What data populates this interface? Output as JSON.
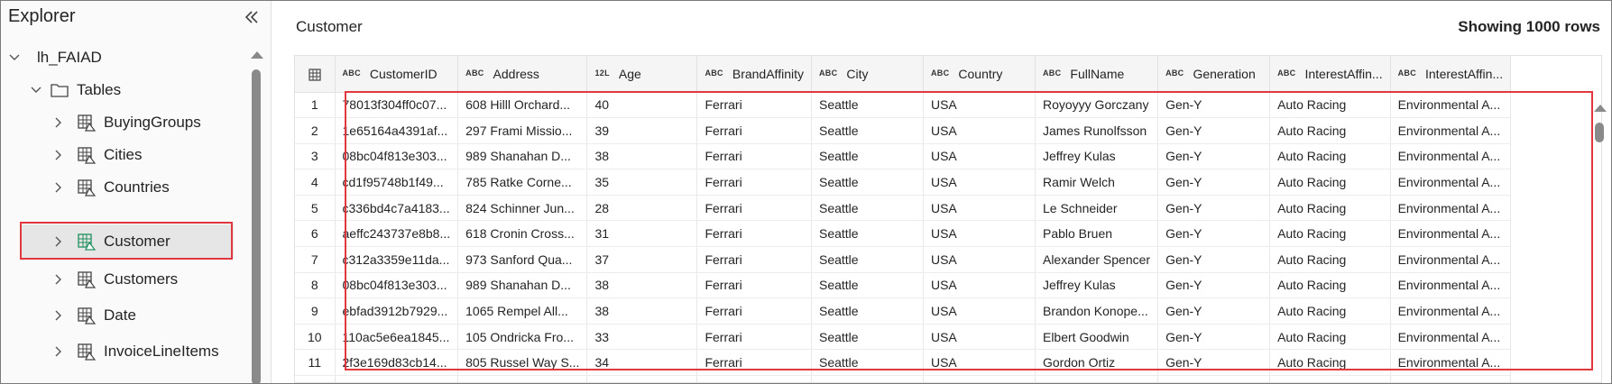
{
  "explorer": {
    "title": "Explorer",
    "lakehouse": "lh_FAIAD",
    "tables_label": "Tables",
    "items": [
      {
        "label": "BuyingGroups"
      },
      {
        "label": "Cities"
      },
      {
        "label": "Countries"
      },
      {
        "label": "Customer",
        "selected": true
      },
      {
        "label": "Customers"
      },
      {
        "label": "Date"
      },
      {
        "label": "InvoiceLineItems"
      }
    ]
  },
  "main": {
    "title": "Customer",
    "rows_count": "Showing 1000 rows"
  },
  "table": {
    "columns": [
      {
        "type": "ABC",
        "name": "CustomerID"
      },
      {
        "type": "ABC",
        "name": "Address"
      },
      {
        "type": "12L",
        "name": "Age"
      },
      {
        "type": "ABC",
        "name": "BrandAffinity"
      },
      {
        "type": "ABC",
        "name": "City"
      },
      {
        "type": "ABC",
        "name": "Country"
      },
      {
        "type": "ABC",
        "name": "FullName"
      },
      {
        "type": "ABC",
        "name": "Generation"
      },
      {
        "type": "ABC",
        "name": "InterestAffin..."
      },
      {
        "type": "ABC",
        "name": "InterestAffin..."
      }
    ],
    "rows": [
      [
        "1",
        "78013f304ff0c07...",
        "608 Hilll Orchard...",
        "40",
        "Ferrari",
        "Seattle",
        "USA",
        "Royoyyy Gorczany",
        "Gen-Y",
        "Auto Racing",
        "Environmental A..."
      ],
      [
        "2",
        "1e65164a4391af...",
        "297 Frami Missio...",
        "39",
        "Ferrari",
        "Seattle",
        "USA",
        "James Runolfsson",
        "Gen-Y",
        "Auto Racing",
        "Environmental A..."
      ],
      [
        "3",
        "08bc04f813e303...",
        "989 Shanahan D...",
        "38",
        "Ferrari",
        "Seattle",
        "USA",
        "Jeffrey Kulas",
        "Gen-Y",
        "Auto Racing",
        "Environmental A..."
      ],
      [
        "4",
        "cd1f95748b1f49...",
        "785 Ratke Corne...",
        "35",
        "Ferrari",
        "Seattle",
        "USA",
        "Ramir Welch",
        "Gen-Y",
        "Auto Racing",
        "Environmental A..."
      ],
      [
        "5",
        "c336bd4c7a4183...",
        "824 Schinner Jun...",
        "28",
        "Ferrari",
        "Seattle",
        "USA",
        "Le Schneider",
        "Gen-Y",
        "Auto Racing",
        "Environmental A..."
      ],
      [
        "6",
        "aeffc243737e8b8...",
        "618 Cronin Cross...",
        "31",
        "Ferrari",
        "Seattle",
        "USA",
        "Pablo Bruen",
        "Gen-Y",
        "Auto Racing",
        "Environmental A..."
      ],
      [
        "7",
        "c312a3359e11da...",
        "973 Sanford Qua...",
        "37",
        "Ferrari",
        "Seattle",
        "USA",
        "Alexander Spencer",
        "Gen-Y",
        "Auto Racing",
        "Environmental A..."
      ],
      [
        "8",
        "08bc04f813e303...",
        "989 Shanahan D...",
        "38",
        "Ferrari",
        "Seattle",
        "USA",
        "Jeffrey Kulas",
        "Gen-Y",
        "Auto Racing",
        "Environmental A..."
      ],
      [
        "9",
        "ebfad3912b7929...",
        "1065 Rempel All...",
        "38",
        "Ferrari",
        "Seattle",
        "USA",
        "Brandon Konope...",
        "Gen-Y",
        "Auto Racing",
        "Environmental A..."
      ],
      [
        "10",
        "110ac5e6ea1845...",
        "105 Ondricka Fro...",
        "33",
        "Ferrari",
        "Seattle",
        "USA",
        "Elbert Goodwin",
        "Gen-Y",
        "Auto Racing",
        "Environmental A..."
      ],
      [
        "11",
        "2f3e169d83cb14...",
        "805 Russel Way S...",
        "34",
        "Ferrari",
        "Seattle",
        "USA",
        "Gordon Ortiz",
        "Gen-Y",
        "Auto Racing",
        "Environmental A..."
      ],
      [
        "",
        "",
        "",
        "",
        "",
        "",
        "",
        "",
        "",
        "",
        ""
      ]
    ]
  },
  "colors": {
    "highlight": "#e0383e",
    "table_icon_green": "#1f8f5f"
  },
  "icons": {
    "collapse": "double-chevron-left-icon",
    "expand": "chevron-right-icon",
    "expanded": "chevron-down-icon",
    "folder": "folder-icon",
    "table": "delta-table-icon",
    "grid": "table-grid-icon"
  }
}
